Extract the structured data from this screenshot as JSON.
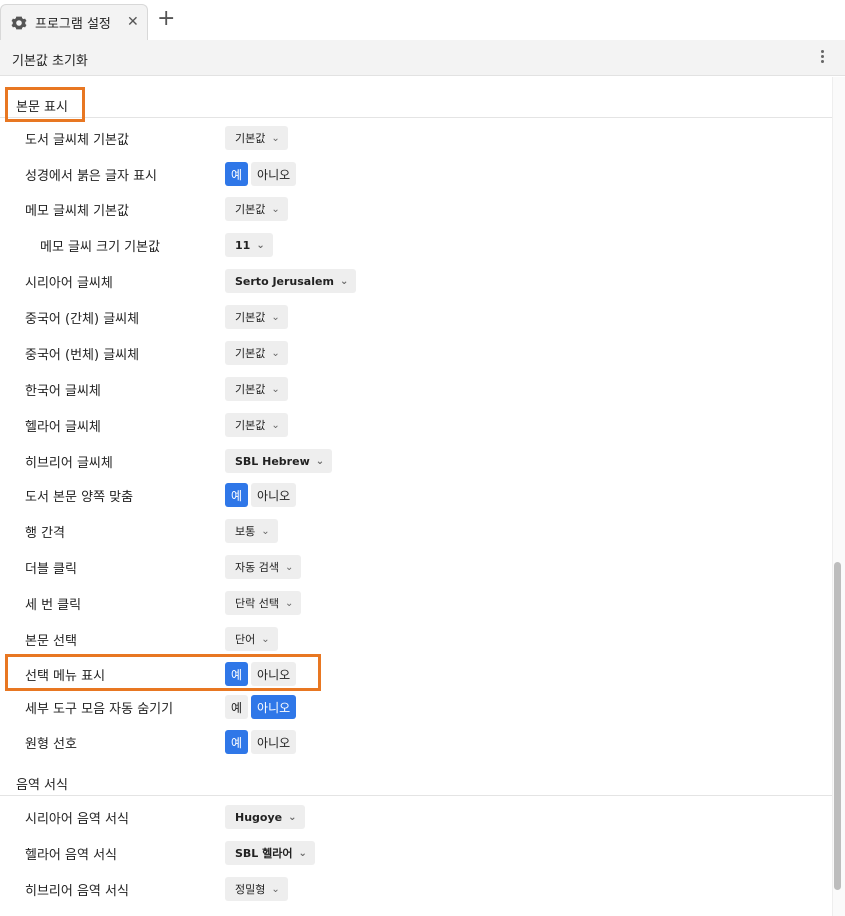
{
  "tab": {
    "title": "프로그램 설정",
    "icon": "gear-icon"
  },
  "toolbar": {
    "reset_label": "기본값 초기화",
    "more_icon": "more-vertical-icon"
  },
  "accent_color": "#2f77e8",
  "highlight_color": "#e87722",
  "sections": {
    "display": "본문 표시",
    "transliteration": "음역 서식"
  },
  "rows": {
    "book_font": {
      "label": "도서 글씨체 기본값",
      "value": "기본값"
    },
    "red_letter": {
      "label": "성경에서 붉은 글자 표시",
      "yes": "예",
      "no": "아니오",
      "selected": "예"
    },
    "note_font": {
      "label": "메모 글씨체 기본값",
      "value": "기본값"
    },
    "note_size": {
      "label": "메모 글씨 크기 기본값",
      "value": "11"
    },
    "syriac_font": {
      "label": "시리아어 글씨체",
      "value": "Serto Jerusalem"
    },
    "chinese_simp": {
      "label": "중국어 (간체) 글씨체",
      "value": "기본값"
    },
    "chinese_trad": {
      "label": "중국어 (번체) 글씨체",
      "value": "기본값"
    },
    "korean_font": {
      "label": "한국어 글씨체",
      "value": "기본값"
    },
    "greek_font": {
      "label": "헬라어 글씨체",
      "value": "기본값"
    },
    "hebrew_font": {
      "label": "히브리어 글씨체",
      "value": "SBL Hebrew"
    },
    "justify": {
      "label": "도서 본문 양쪽 맞춤",
      "yes": "예",
      "no": "아니오",
      "selected": "예"
    },
    "line_spacing": {
      "label": "행 간격",
      "value": "보통"
    },
    "double_click": {
      "label": "더블 클릭",
      "value": "자동 검색"
    },
    "triple_click": {
      "label": "세 번 클릭",
      "value": "단락 선택"
    },
    "text_select": {
      "label": "본문 선택",
      "value": "단어"
    },
    "selection_menu": {
      "label": "선택 메뉴 표시",
      "yes": "예",
      "no": "아니오",
      "selected": "예"
    },
    "autohide_toolbar": {
      "label": "세부 도구 모음 자동 숨기기",
      "yes": "예",
      "no": "아니오",
      "selected": "아니오"
    },
    "prefer_lemma": {
      "label": "원형 선호",
      "yes": "예",
      "no": "아니오",
      "selected": "예"
    },
    "syriac_translit": {
      "label": "시리아어 음역 서식",
      "value": "Hugoye"
    },
    "greek_translit": {
      "label": "헬라어 음역 서식",
      "value": "SBL 헬라어"
    },
    "hebrew_translit": {
      "label": "히브리어 음역 서식",
      "value": "정밀형"
    }
  }
}
